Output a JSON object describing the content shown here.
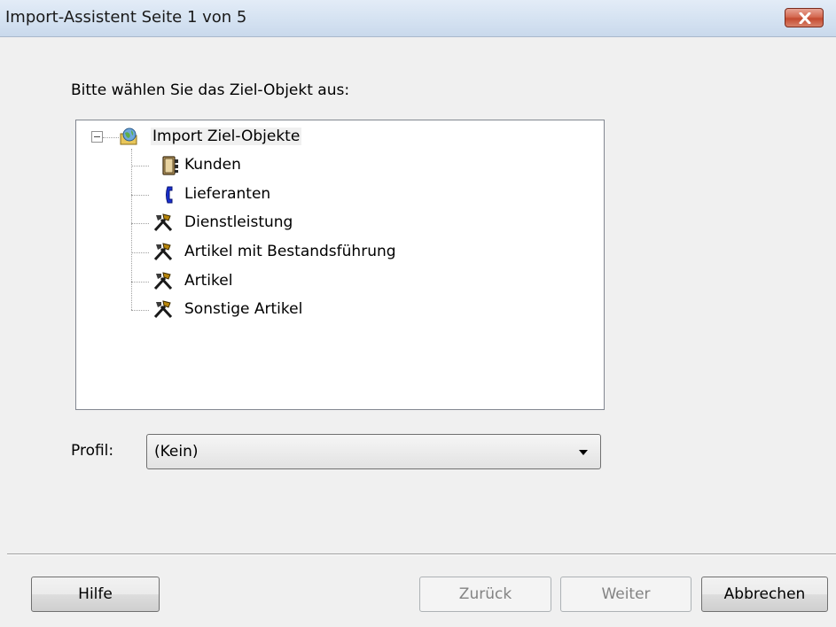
{
  "window": {
    "title": "Import-Assistent Seite 1 von 5",
    "close_icon": "close-icon"
  },
  "prompt": "Bitte wählen Sie das Ziel-Objekt aus:",
  "tree": {
    "root": {
      "label": "Import Ziel-Objekte",
      "icon": "globe-folder-icon",
      "expanded": true
    },
    "items": [
      {
        "label": "Kunden",
        "icon": "address-book-icon"
      },
      {
        "label": "Lieferanten",
        "icon": "telephone-icon"
      },
      {
        "label": "Dienstleistung",
        "icon": "tools-icon"
      },
      {
        "label": "Artikel mit Bestandsführung",
        "icon": "tools-icon"
      },
      {
        "label": "Artikel",
        "icon": "tools-icon"
      },
      {
        "label": "Sonstige Artikel",
        "icon": "tools-icon"
      }
    ]
  },
  "profile": {
    "label": "Profil:",
    "selected": "(Kein)"
  },
  "buttons": {
    "help": "Hilfe",
    "back": "Zurück",
    "next": "Weiter",
    "cancel": "Abbrechen"
  }
}
